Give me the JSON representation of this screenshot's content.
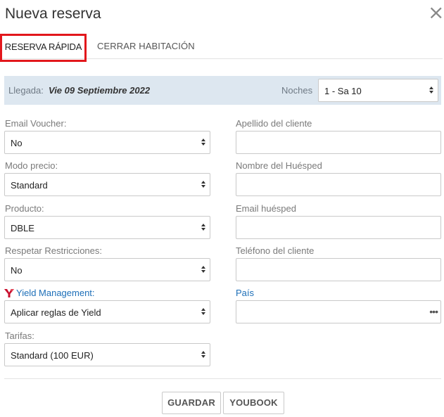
{
  "dialog": {
    "title": "Nueva reserva",
    "close_icon": "close-icon"
  },
  "tabs": [
    {
      "label": "RESERVA RÁPIDA",
      "active": true
    },
    {
      "label": "CERRAR HABITACIÓN",
      "active": false
    }
  ],
  "arrival": {
    "label": "Llegada:",
    "value": "Vie 09 Septiembre 2022",
    "nights_label": "Noches",
    "nights_value": "1 - Sa 10"
  },
  "left_fields": {
    "email_voucher": {
      "label": "Email Voucher:",
      "value": "No"
    },
    "price_mode": {
      "label": "Modo precio:",
      "value": "Standard"
    },
    "product": {
      "label": "Producto:",
      "value": "DBLE"
    },
    "restrictions": {
      "label": "Respetar Restricciones:",
      "value": "No"
    },
    "yield": {
      "label": "Yield Management:",
      "value": "Aplicar reglas de Yield",
      "icon": "yield-logo-icon"
    },
    "rates": {
      "label": "Tarifas:",
      "value": "Standard (100 EUR)"
    }
  },
  "right_fields": {
    "surname": {
      "label": "Apellido del cliente",
      "value": ""
    },
    "guest_name": {
      "label": "Nombre del Huésped",
      "value": ""
    },
    "guest_email": {
      "label": "Email huésped",
      "value": ""
    },
    "phone": {
      "label": "Teléfono del cliente",
      "value": ""
    },
    "country": {
      "label": "País",
      "value": "",
      "icon": "more-dots-icon"
    }
  },
  "buttons": {
    "save": "GUARDAR",
    "youbook": "YOUBOOK"
  },
  "colors": {
    "active_tab_border": "#e2171c",
    "arrival_bar_bg": "#dde7f0",
    "link_label": "#1d6fb8"
  }
}
